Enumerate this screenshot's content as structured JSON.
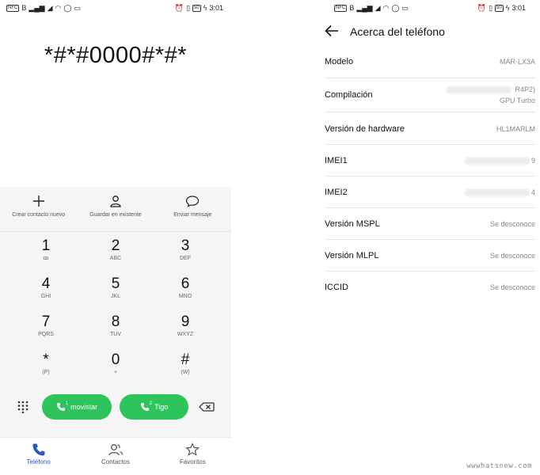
{
  "status_bar": {
    "carrier_chip": "NFC",
    "sim_tag": "B",
    "battery": "50",
    "time": "3:01"
  },
  "dialer": {
    "entered_code": "*#*#0000#*#*",
    "actions": [
      {
        "label": "Crear contacto nuevo",
        "icon": "plus-icon"
      },
      {
        "label": "Guardar en existente",
        "icon": "person-icon"
      },
      {
        "label": "Enviar mensaje",
        "icon": "chat-bubble-icon"
      }
    ],
    "keys": [
      {
        "digit": "1",
        "sub": "ꝏ"
      },
      {
        "digit": "2",
        "sub": "ABC"
      },
      {
        "digit": "3",
        "sub": "DEF"
      },
      {
        "digit": "4",
        "sub": "GHI"
      },
      {
        "digit": "5",
        "sub": "JKL"
      },
      {
        "digit": "6",
        "sub": "MNO"
      },
      {
        "digit": "7",
        "sub": "PQRS"
      },
      {
        "digit": "8",
        "sub": "TUV"
      },
      {
        "digit": "9",
        "sub": "WXYZ"
      },
      {
        "digit": "*",
        "sub": "(P)"
      },
      {
        "digit": "0",
        "sub": "+"
      },
      {
        "digit": "#",
        "sub": "(W)"
      }
    ],
    "call_buttons": [
      {
        "label": "movistar",
        "sim": "1"
      },
      {
        "label": "Tigo",
        "sim": "2"
      }
    ]
  },
  "bottom_nav": [
    {
      "label": "Teléfono",
      "icon": "phone-icon",
      "active": true
    },
    {
      "label": "Contactos",
      "icon": "contacts-icon",
      "active": false
    },
    {
      "label": "Favoritos",
      "icon": "star-icon",
      "active": false
    }
  ],
  "about": {
    "title": "Acerca del teléfono",
    "rows": [
      {
        "label": "Modelo",
        "value": "MAR-LX3A"
      },
      {
        "label": "Compilación",
        "value": "R4P2)",
        "value2": "GPU Turbo",
        "redacted": true
      },
      {
        "label": "Versión de hardware",
        "value": "HL1MARLM"
      },
      {
        "label": "IMEI1",
        "value": "9",
        "redacted": true
      },
      {
        "label": "IMEI2",
        "value": "4",
        "redacted": true
      },
      {
        "label": "Versión MSPL",
        "value": "Se desconoce"
      },
      {
        "label": "Versión MLPL",
        "value": "Se desconoce"
      },
      {
        "label": "ICCID",
        "value": "Se desconoce"
      }
    ]
  },
  "watermark": "wwwhatsnew.com",
  "colors": {
    "call_green": "#2ec45c",
    "active_blue": "#2b57c3"
  }
}
